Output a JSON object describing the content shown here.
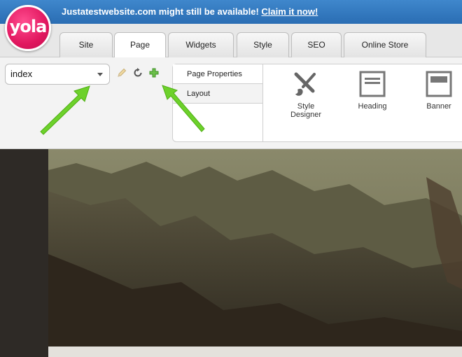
{
  "banner": {
    "site_name": "Justatestwebsite.com",
    "message": "might still be available!",
    "claim_link": "Claim it now!"
  },
  "logo": {
    "text": "yola"
  },
  "tabs": [
    {
      "label": "Site"
    },
    {
      "label": "Page"
    },
    {
      "label": "Widgets"
    },
    {
      "label": "Style"
    },
    {
      "label": "SEO"
    },
    {
      "label": "Online Store"
    }
  ],
  "active_tab": "Page",
  "page_selector": {
    "value": "index"
  },
  "tool_icons": [
    "pencil-icon",
    "refresh-icon",
    "add-icon"
  ],
  "props": {
    "tabs": [
      {
        "label": "Page Properties"
      },
      {
        "label": "Layout"
      }
    ]
  },
  "widgets": [
    {
      "label": "Style Designer",
      "icon": "brush-icon"
    },
    {
      "label": "Heading",
      "icon": "heading-icon"
    },
    {
      "label": "Banner",
      "icon": "banner-icon"
    }
  ],
  "colors": {
    "banner": "#2f78c1",
    "logo": "#e1175f",
    "arrow": "#6dd12b"
  }
}
